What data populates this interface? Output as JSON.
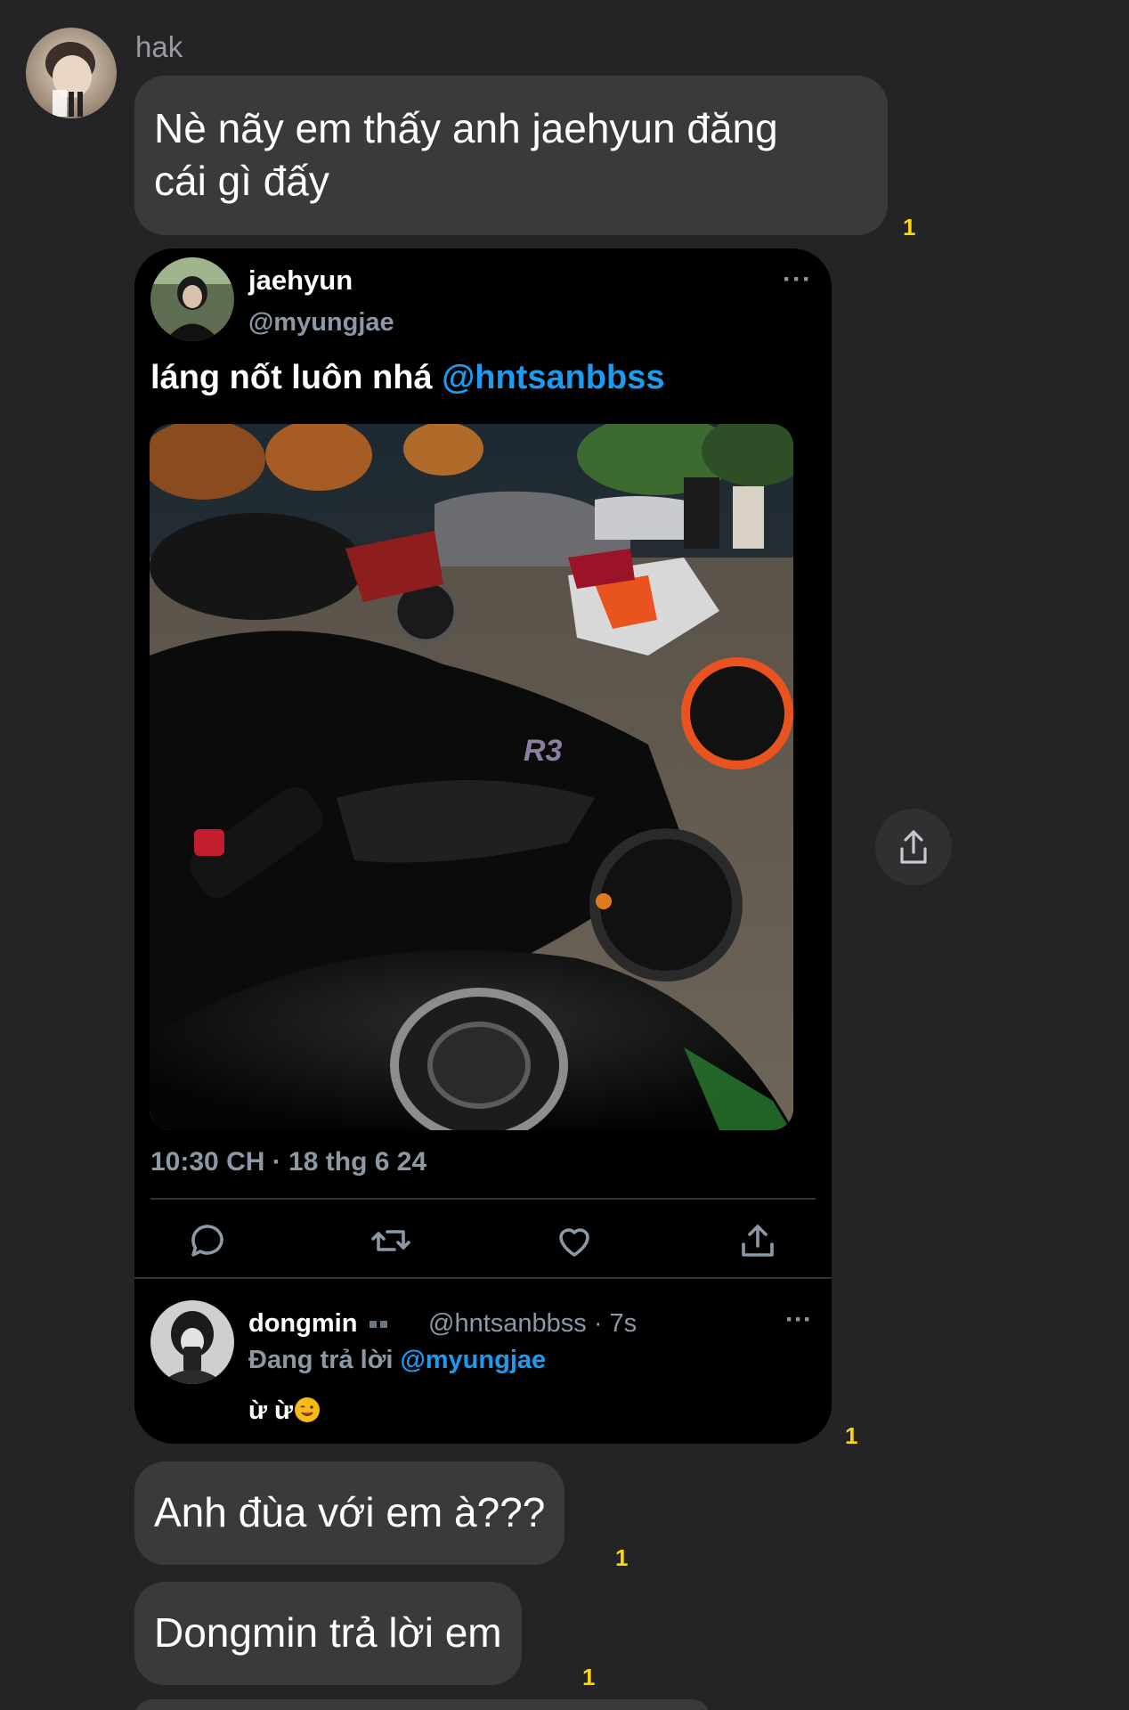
{
  "conversation": {
    "sender_name": "hak",
    "messages": [
      {
        "text_line1": "Nè nãy em thấy anh jaehyun đăng",
        "text_line2": "cái gì đấy",
        "read_count": "1"
      },
      {
        "read_count": "1"
      },
      {
        "text": "Anh đùa với em à???",
        "read_count": "1"
      },
      {
        "text": "Dongmin trả lời em",
        "read_count": "1"
      }
    ]
  },
  "tweet": {
    "display_name": "jaehyun",
    "handle": "@myungjae",
    "more_icon": "···",
    "text": "láng nốt luôn nhá ",
    "mention": "@hntsanbbss",
    "timestamp": "10:30 CH · 18 thg 6 24",
    "actions": [
      "reply-icon",
      "retweet-icon",
      "like-icon",
      "share-icon"
    ],
    "reply": {
      "display_name": "dongmin",
      "handle_time": "@hntsanbbss · 7s",
      "replying_prefix": "Đang trả lời ",
      "replying_to": "@myungjae",
      "text": "ừ ừ"
    }
  },
  "colors": {
    "background": "#242426",
    "bubble": "#3a3a3c",
    "read_receipt": "#ffd60a",
    "mention": "#1d9bf0"
  }
}
